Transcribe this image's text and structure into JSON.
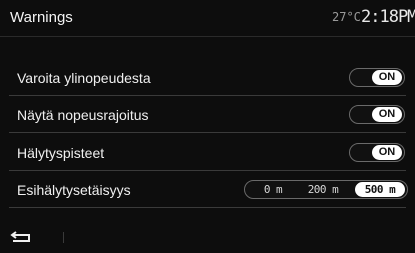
{
  "header": {
    "title": "Warnings",
    "temperature": "27°C",
    "time": "2:18PM"
  },
  "settings": [
    {
      "label": "Varoita ylinopeudesta",
      "value": "ON"
    },
    {
      "label": "Näytä nopeusrajoitus",
      "value": "ON"
    },
    {
      "label": "Hälytyspisteet",
      "value": "ON"
    }
  ],
  "distance_setting": {
    "label": "Esihälytysetäisyys",
    "options": [
      "0 m",
      "200 m",
      "500 m"
    ],
    "selected": "500 m"
  },
  "footer": {
    "back_icon": "back-arrow-icon"
  },
  "colors": {
    "background": "#0d0d0d",
    "text": "#f0f0f0",
    "toggle_knob": "#ffffff",
    "divider": "#3a3a3a"
  }
}
